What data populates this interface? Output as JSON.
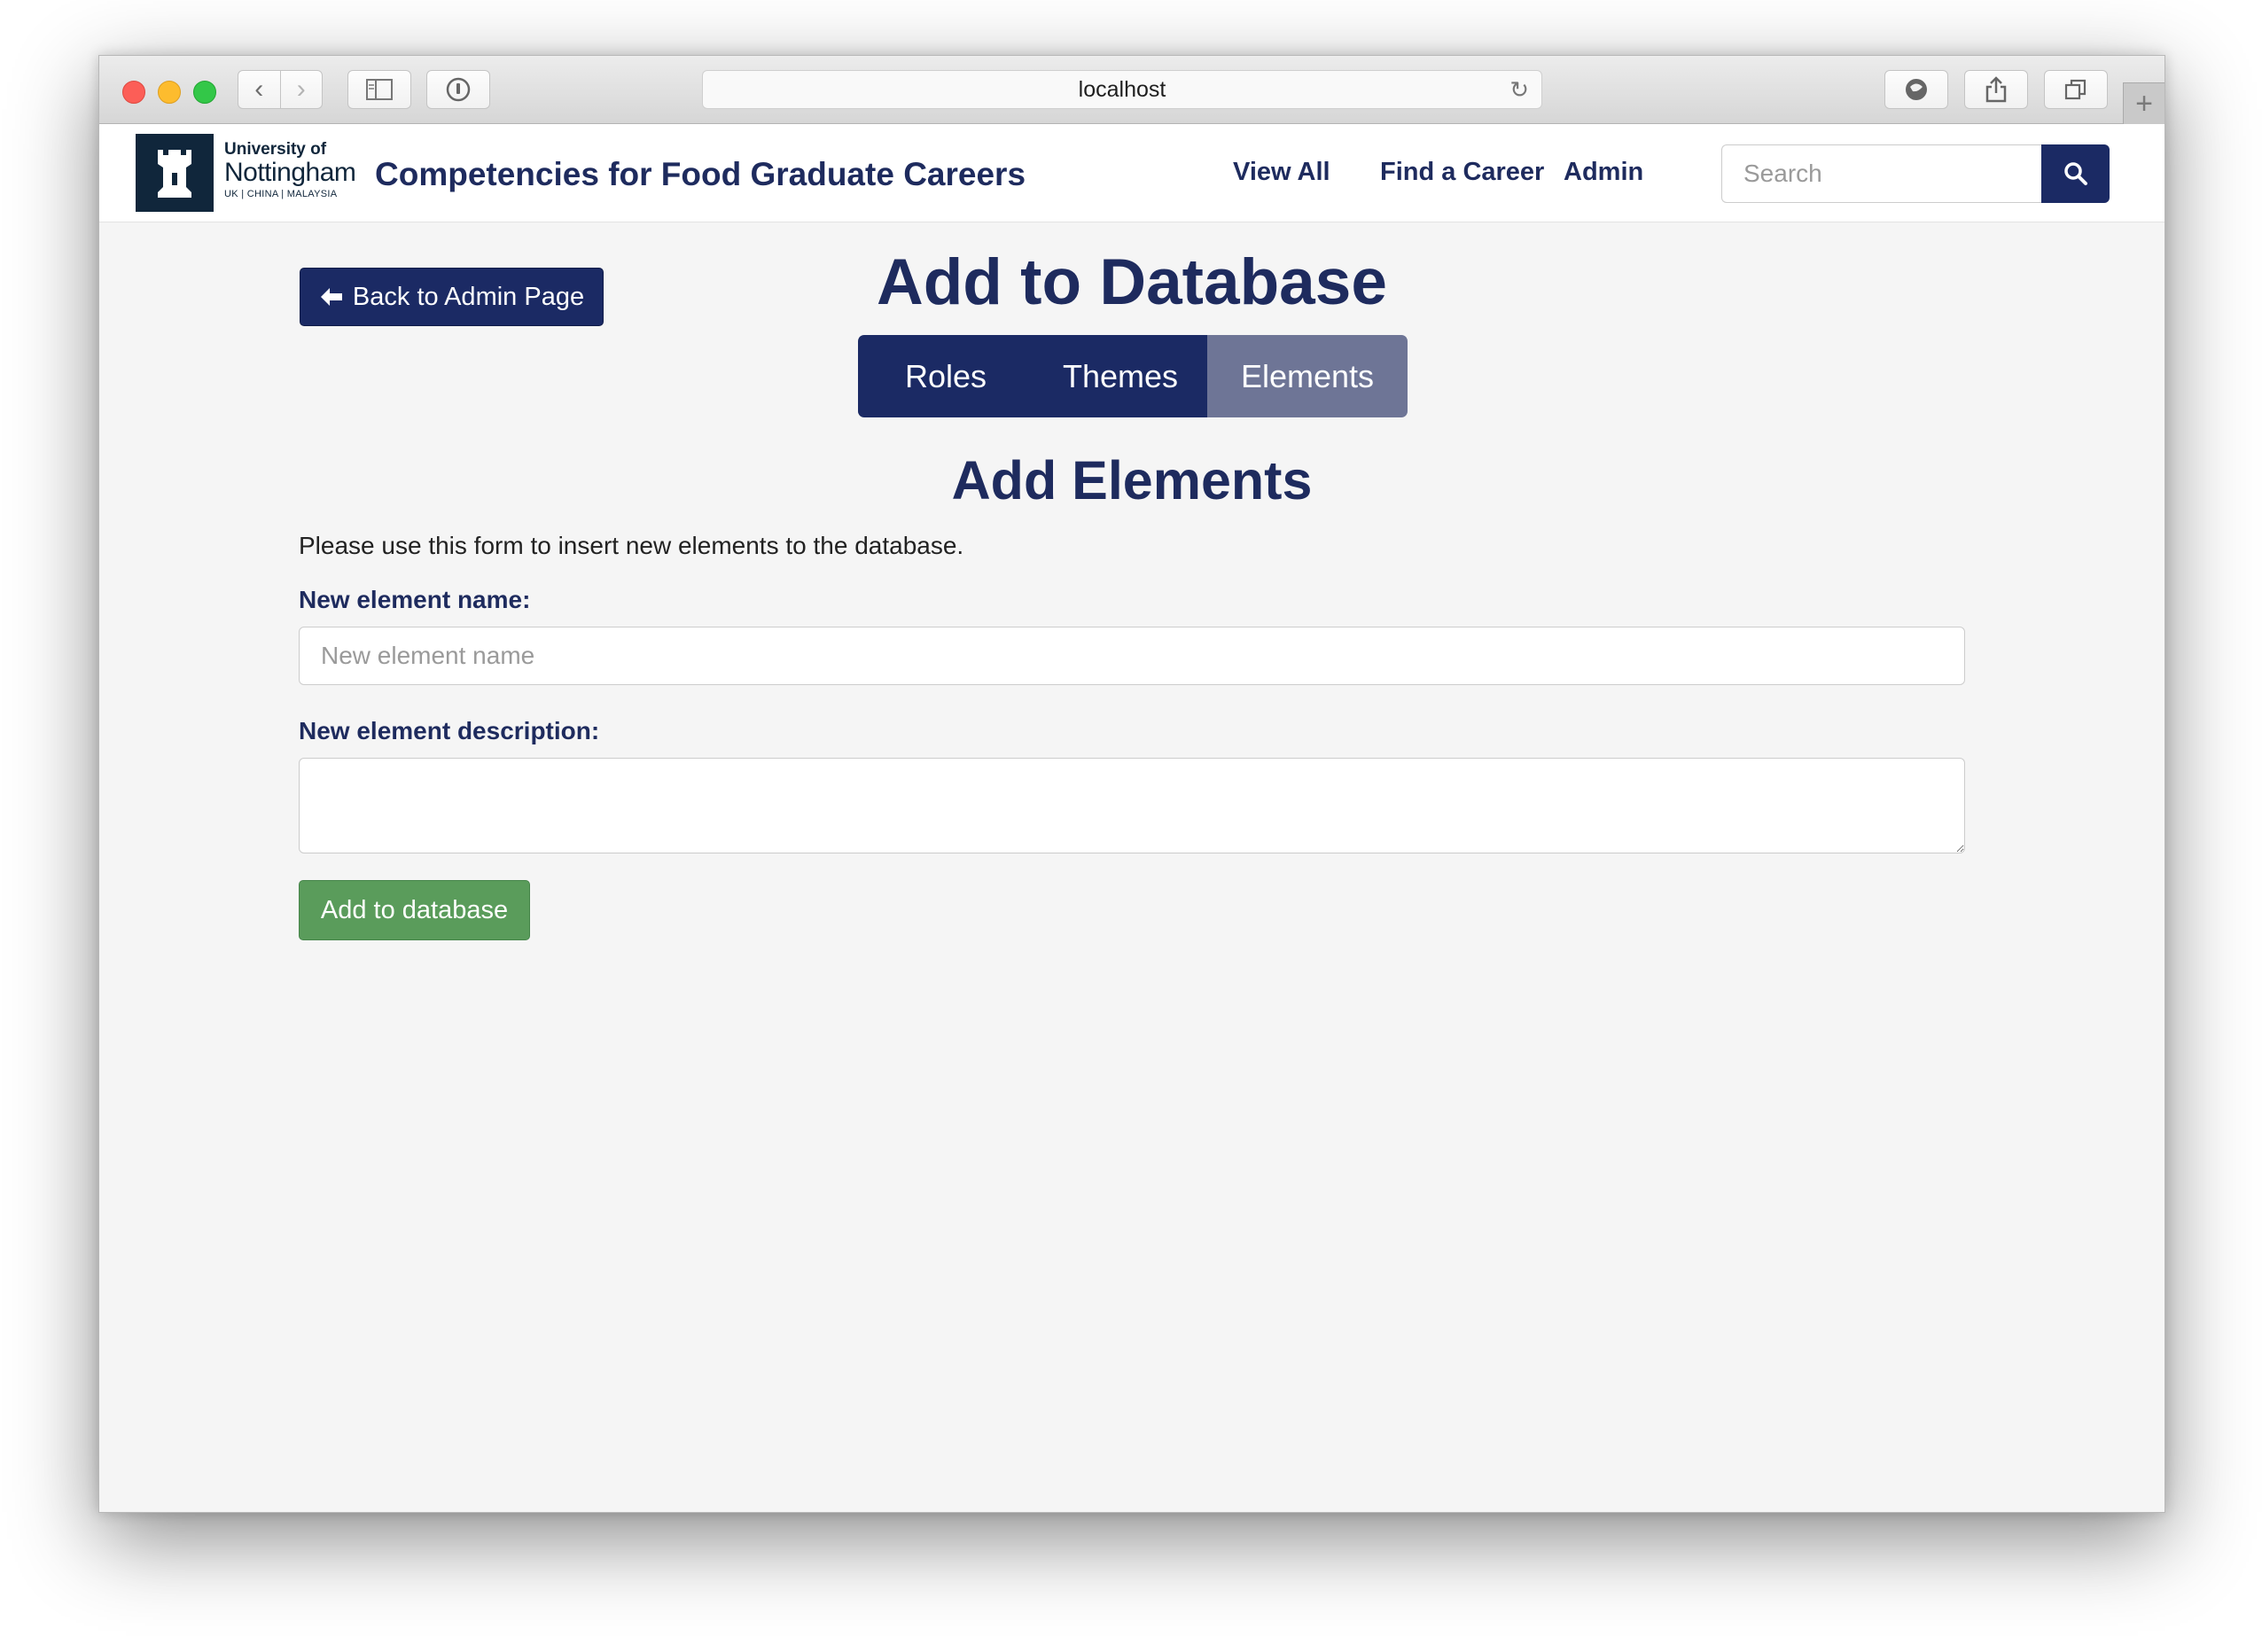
{
  "browser": {
    "url": "localhost",
    "icons": [
      "back-icon",
      "forward-icon",
      "sidebar-icon",
      "password-icon",
      "reload-icon",
      "extension-icon",
      "share-icon",
      "tabs-icon",
      "new-tab-icon"
    ]
  },
  "site": {
    "logo": {
      "line1": "University of",
      "line2": "Nottingham",
      "line3": "UK | CHINA | MALAYSIA"
    },
    "title": "Competencies for Food Graduate Careers",
    "nav": {
      "view_all": "View All",
      "find_career": "Find a Career",
      "admin": "Admin"
    },
    "search": {
      "placeholder": "Search"
    }
  },
  "main": {
    "back_label": "Back to Admin Page",
    "page_title": "Add to Database",
    "tabs": [
      {
        "label": "Roles",
        "active": false
      },
      {
        "label": "Themes",
        "active": false
      },
      {
        "label": "Elements",
        "active": true
      }
    ],
    "section_title": "Add Elements",
    "intro": "Please use this form to insert new elements to the database.",
    "form": {
      "name_label": "New element name:",
      "name_placeholder": "New element name",
      "description_label": "New element description:",
      "submit_label": "Add to database"
    }
  },
  "colors": {
    "brand_navy": "#1b2a64",
    "active_tab": "#6e7596",
    "submit_green": "#5a9c5b"
  }
}
